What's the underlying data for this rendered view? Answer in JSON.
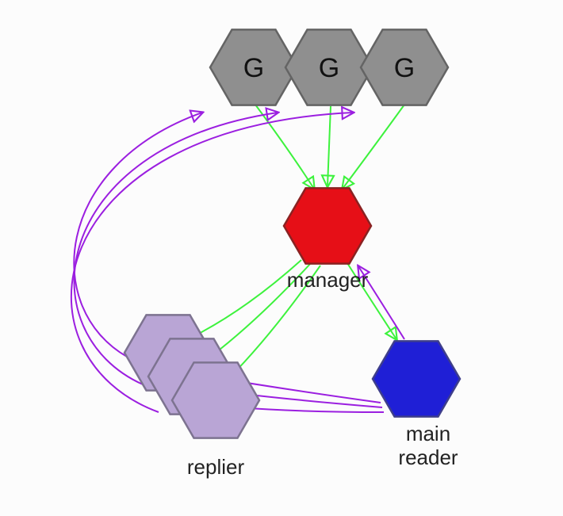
{
  "diagram": {
    "nodes": {
      "g1": {
        "label": "G",
        "fill": "#8f8f8f",
        "stroke": "#646464"
      },
      "g2": {
        "label": "G",
        "fill": "#8f8f8f",
        "stroke": "#646464"
      },
      "g3": {
        "label": "G",
        "fill": "#8f8f8f",
        "stroke": "#646464"
      },
      "manager": {
        "label": "manager",
        "fill": "#e60f17",
        "stroke": "#8a2222"
      },
      "replier1": {
        "label": "",
        "fill": "#b9a5d5",
        "stroke": "#7d7390"
      },
      "replier2": {
        "label": "",
        "fill": "#b9a5d5",
        "stroke": "#7d7390"
      },
      "replier3": {
        "label": "",
        "fill": "#b9a5d5",
        "stroke": "#7d7390"
      },
      "repliers_label": "replier",
      "main_reader": {
        "label_line1": "main",
        "label_line2": "reader",
        "fill": "#1f1fd6",
        "stroke": "#3f3f8b"
      }
    },
    "edge_colors": {
      "green": "#3df23d",
      "purple": "#9b1fe0"
    },
    "edges": [
      {
        "from": "g1",
        "to": "manager",
        "color": "green"
      },
      {
        "from": "g2",
        "to": "manager",
        "color": "green"
      },
      {
        "from": "g3",
        "to": "manager",
        "color": "green"
      },
      {
        "from": "manager",
        "to": "replier1",
        "color": "green"
      },
      {
        "from": "manager",
        "to": "replier2",
        "color": "green"
      },
      {
        "from": "manager",
        "to": "replier3",
        "color": "green"
      },
      {
        "from": "manager",
        "to": "main_reader",
        "color": "green"
      },
      {
        "from": "main_reader",
        "to": "manager",
        "color": "purple"
      },
      {
        "from": "main_reader",
        "to": "replier1",
        "color": "purple"
      },
      {
        "from": "main_reader",
        "to": "replier2",
        "color": "purple"
      },
      {
        "from": "main_reader",
        "to": "replier3",
        "color": "purple"
      },
      {
        "from": "replier1",
        "to": "g1",
        "color": "purple",
        "via": "left-curve"
      },
      {
        "from": "replier2",
        "to": "g2",
        "color": "purple",
        "via": "left-curve"
      },
      {
        "from": "replier3",
        "to": "g3",
        "color": "purple",
        "via": "left-curve"
      }
    ]
  }
}
